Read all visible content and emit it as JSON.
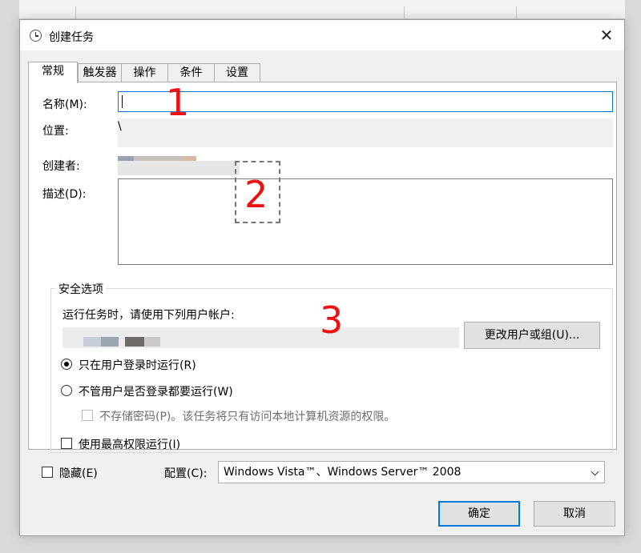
{
  "dialog": {
    "title": "创建任务",
    "close_glyph": "✕"
  },
  "tabs": [
    {
      "label": "常规",
      "active": true
    },
    {
      "label": "触发器",
      "active": false
    },
    {
      "label": "操作",
      "active": false
    },
    {
      "label": "条件",
      "active": false
    },
    {
      "label": "设置",
      "active": false
    }
  ],
  "general": {
    "name_label": "名称(M):",
    "name_value": "",
    "location_label": "位置:",
    "location_value": "\\",
    "author_label": "创建者:",
    "description_label": "描述(D):"
  },
  "security": {
    "group_title": "安全选项",
    "run_as_prompt": "运行任务时，请使用下列用户帐户:",
    "change_user_button": "更改用户或组(U)...",
    "radio_logged_on": "只在用户登录时运行(R)",
    "radio_whether_logged_on": "不管用户是否登录都要运行(W)",
    "no_store_password": "不存储密码(P)。该任务将只有访问本地计算机资源的权限。",
    "highest_privileges": "使用最高权限运行(I)"
  },
  "footer": {
    "hidden_label": "隐藏(E)",
    "config_label": "配置(C):",
    "config_value": "Windows Vista™、Windows Server™ 2008",
    "ok_button": "确定",
    "cancel_button": "取消"
  },
  "annotations": [
    "1",
    "2",
    "3"
  ],
  "colors": {
    "accent": "#0078d7",
    "annotation": "#ee1111"
  }
}
